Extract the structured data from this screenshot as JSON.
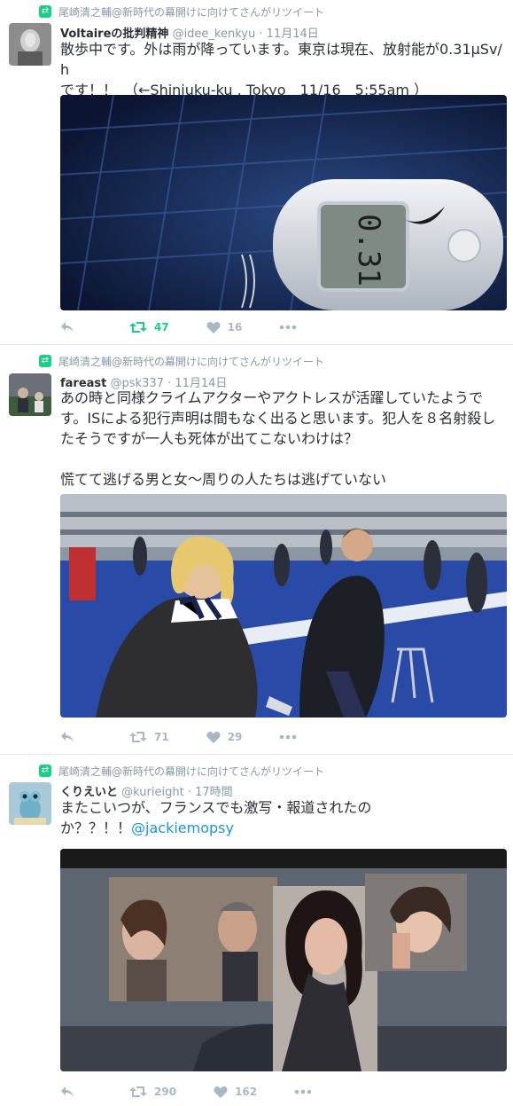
{
  "retweet_label": "尾崎清之輔@新時代の幕開けに向けてさんがリツイート",
  "tweets": [
    {
      "name": "Voltaireの批判精神",
      "handle": "@idee_kenkyu",
      "time": "11月14日",
      "text_lines": [
        "散歩中です。外は雨が降っています。東京は現在、放射能が0.31μSv/h",
        "です！！　（←Shinjuku-ku , Tokyo　11/16　5:55am ）"
      ],
      "retweets": "47",
      "likes": "16",
      "media_desc": "dosimeter"
    },
    {
      "name": "fareast",
      "handle": "@psk337",
      "time": "11月14日",
      "text_lines": [
        "あの時と同様クライムアクターやアクトレスが活躍していたようで",
        "す。ISによる犯行声明は間もなく出ると思います。犯人を８名射殺し",
        "たそうですが一人も死体が出てこないわけは？",
        "",
        "慌てて逃げる男と女～周りの人たちは逃げていない"
      ],
      "retweets": "71",
      "likes": "29",
      "media_desc": "stadium"
    },
    {
      "name": "くりえいと",
      "handle": "@kurieight",
      "time": "17時間",
      "text_lines": [
        "またこいつが、フランスでも激写・報道されたの",
        "か？？！！"
      ],
      "mention": "@jackiemopsy",
      "retweets": "290",
      "likes": "162",
      "media_desc": "collage"
    }
  ],
  "colors": {
    "retweet_green": "#19cf86",
    "muted": "#8899a6",
    "link": "#1b95e0"
  }
}
